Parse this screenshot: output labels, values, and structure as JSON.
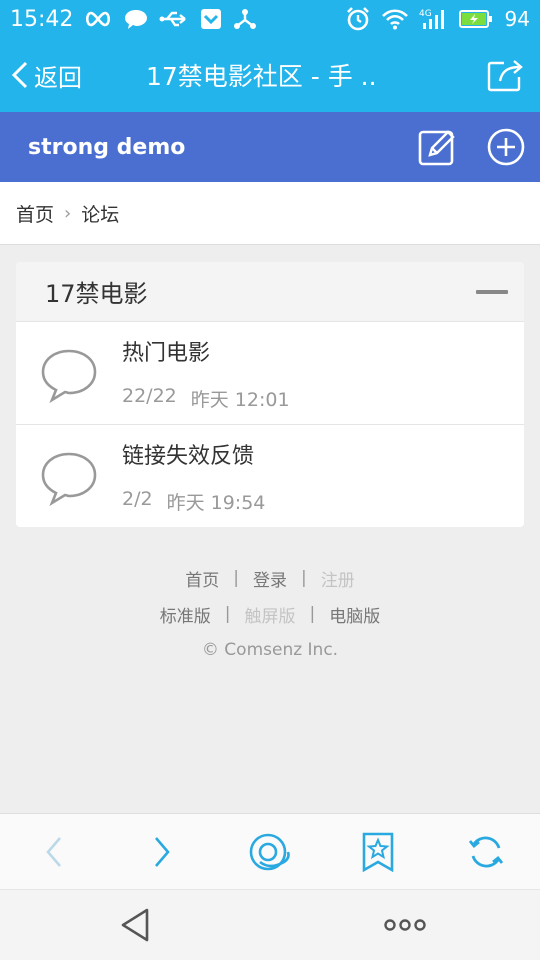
{
  "status_bar": {
    "time": "15:42",
    "network_type": "4G",
    "battery_level": "94",
    "icons": [
      "infinity-icon",
      "chat-bubble-icon",
      "usb-icon",
      "shield-icon",
      "share-network-icon",
      "alarm-icon",
      "wifi-icon",
      "signal-icon",
      "battery-charging-icon"
    ]
  },
  "title_bar": {
    "back_label": "返回",
    "title": "17禁电影社区 - 手 .."
  },
  "forum_header": {
    "site_name": "strong demo"
  },
  "breadcrumb": {
    "items": [
      "首页",
      "论坛"
    ],
    "separator": "›"
  },
  "section": {
    "title": "17禁电影",
    "forums": [
      {
        "name": "热门电影",
        "counts": "22/22",
        "last_post": "昨天 12:01"
      },
      {
        "name": "链接失效反馈",
        "counts": "2/2",
        "last_post": "昨天 19:54"
      }
    ]
  },
  "footer": {
    "line1": [
      {
        "label": "首页",
        "dim": false
      },
      {
        "label": "登录",
        "dim": false
      },
      {
        "label": "注册",
        "dim": true
      }
    ],
    "line2": [
      {
        "label": "标准版",
        "dim": false
      },
      {
        "label": "触屏版",
        "dim": true
      },
      {
        "label": "电脑版",
        "dim": false
      }
    ],
    "separator": "|",
    "copyright": "© Comsenz Inc."
  },
  "colors": {
    "status_bar": "#22b4ea",
    "forum_header": "#4a6fd1",
    "toolbar_icon": "#2aa9e0",
    "toolbar_icon_disabled": "#bcd9ea"
  }
}
